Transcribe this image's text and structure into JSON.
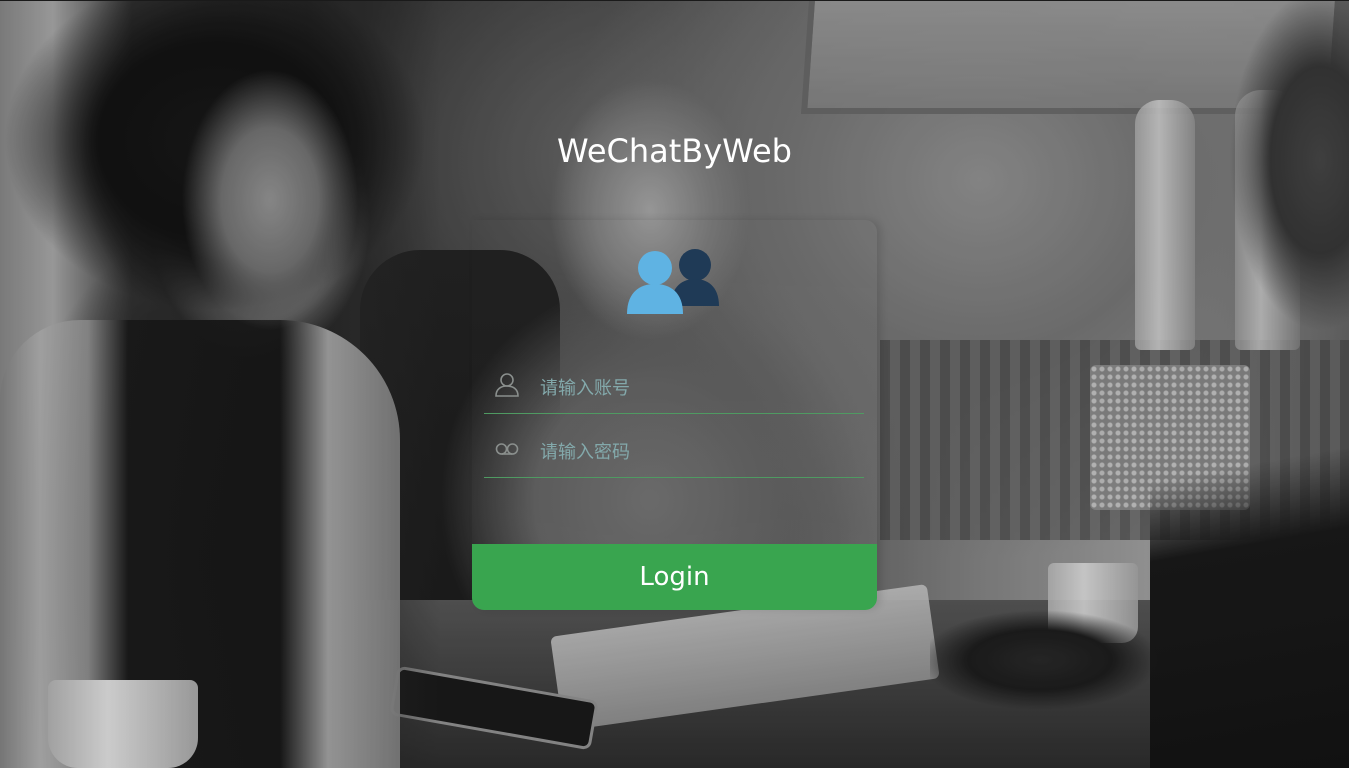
{
  "app": {
    "title": "WeChatByWeb"
  },
  "logo": {
    "icon": "users-icon",
    "colors": {
      "front": "#5fb3e3",
      "back": "#1f3a56"
    }
  },
  "login_form": {
    "account": {
      "icon": "user-icon",
      "value": "",
      "placeholder": "请输入账号"
    },
    "password": {
      "icon": "lock-icon",
      "value": "",
      "placeholder": "请输入密码"
    },
    "submit_label": "Login"
  },
  "colors": {
    "primary_button": "#39a54f",
    "field_underline": "#4f9a62",
    "placeholder_text": "#83a9ab",
    "title_text": "#ffffff"
  }
}
